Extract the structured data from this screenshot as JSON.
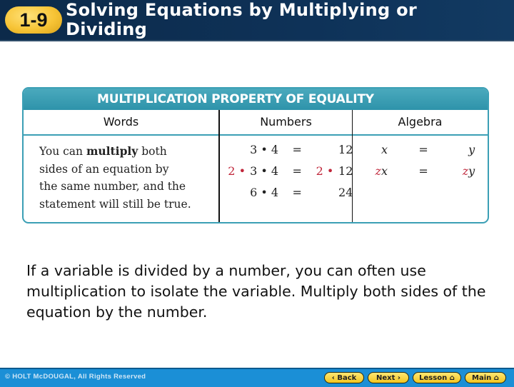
{
  "header": {
    "lesson_number": "1-9",
    "title_line1": "Solving Equations by Multiplying or",
    "title_line2": "Dividing"
  },
  "property_box": {
    "title": "MULTIPLICATION PROPERTY OF EQUALITY",
    "columns": [
      "Words",
      "Numbers",
      "Algebra"
    ],
    "words": {
      "line1_pre": "You can ",
      "line1_bold": "multiply",
      "line1_post": " both",
      "line2": "sides of an equation by",
      "line3": "the same number, and the",
      "line4": "statement will still be true."
    },
    "numbers": [
      {
        "prefix": "",
        "left": "3 • 4",
        "eq": "=",
        "right_prefix": "",
        "right": "12"
      },
      {
        "prefix": "2 •",
        "left": "3 • 4",
        "eq": "=",
        "right_prefix": "2 •",
        "right": "12"
      },
      {
        "prefix": "",
        "left": "6 • 4",
        "eq": "=",
        "right_prefix": "",
        "right": "24"
      }
    ],
    "algebra": [
      {
        "left_prefix": "",
        "left": "x",
        "eq": "=",
        "right_prefix": "",
        "right": "y"
      },
      {
        "left_prefix": "z",
        "left": "x",
        "eq": "=",
        "right_prefix": "z",
        "right": "y"
      }
    ],
    "highlight_color": "#c0263a"
  },
  "body": {
    "paragraph": "If a variable is divided by a number, you can often use multiplication to isolate the variable. Multiply both sides of the equation by the number."
  },
  "footer": {
    "copyright": "© HOLT McDOUGAL, All Rights Reserved",
    "nav": {
      "back": "‹ Back",
      "next": "Next ›",
      "lesson": "Lesson",
      "main": "Main",
      "home_icon": "⌂"
    }
  }
}
